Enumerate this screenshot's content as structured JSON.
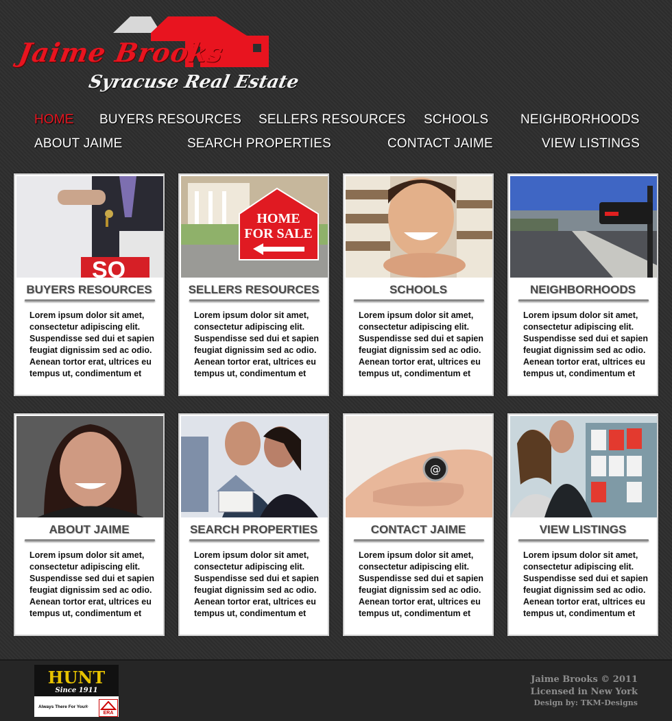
{
  "logo": {
    "name": "Jaime Brooks",
    "tagline": "Syracuse Real Estate"
  },
  "colors": {
    "accent": "#e8141f",
    "background": "#2e2e2e",
    "card": "#ffffff"
  },
  "nav": [
    {
      "label": "HOME",
      "active": true
    },
    {
      "label": "BUYERS RESOURCES"
    },
    {
      "label": "SELLERS RESOURCES"
    },
    {
      "label": "SCHOOLS"
    },
    {
      "label": "NEIGHBORHOODS"
    },
    {
      "label": "ABOUT JAIME"
    },
    {
      "label": "SEARCH PROPERTIES"
    },
    {
      "label": "CONTACT JAIME"
    },
    {
      "label": "VIEW LISTINGS"
    }
  ],
  "cards": [
    {
      "title": "BUYERS RESOURCES",
      "image": "hand-holding-keys-photo",
      "text": "Lorem ipsum dolor sit amet, consectetur adipiscing elit. Suspendisse sed dui et sapien feugiat dignissim sed ac odio. Aenean tortor erat, ultrices eu tempus ut, condimentum et"
    },
    {
      "title": "SELLERS RESOURCES",
      "image": "home-for-sale-sign-photo",
      "sign_text": "HOME FOR SALE",
      "text": "Lorem ipsum dolor sit amet, consectetur adipiscing elit. Suspendisse sed dui et sapien feugiat dignissim sed ac odio. Aenean tortor erat, ultrices eu tempus ut, condimentum et"
    },
    {
      "title": "SCHOOLS",
      "image": "smiling-child-books-photo",
      "text": "Lorem ipsum dolor sit amet, consectetur adipiscing elit. Suspendisse sed dui et sapien feugiat dignissim sed ac odio. Aenean tortor erat, ultrices eu tempus ut, condimentum et"
    },
    {
      "title": "NEIGHBORHOODS",
      "image": "mailbox-street-photo",
      "text": "Lorem ipsum dolor sit amet, consectetur adipiscing elit. Suspendisse sed dui et sapien feugiat dignissim sed ac odio. Aenean tortor erat, ultrices eu tempus ut, condimentum et"
    },
    {
      "title": "ABOUT JAIME",
      "image": "agent-portrait-photo",
      "text": "Lorem ipsum dolor sit amet, consectetur adipiscing elit. Suspendisse sed dui et sapien feugiat dignissim sed ac odio. Aenean tortor erat, ultrices eu tempus ut, condimentum et"
    },
    {
      "title": "SEARCH PROPERTIES",
      "image": "couple-house-model-photo",
      "text": "Lorem ipsum dolor sit amet, consectetur adipiscing elit. Suspendisse sed dui et sapien feugiat dignissim sed ac odio. Aenean tortor erat, ultrices eu tempus ut, condimentum et"
    },
    {
      "title": "CONTACT JAIME",
      "image": "hand-email-button-photo",
      "text": "Lorem ipsum dolor sit amet, consectetur adipiscing elit. Suspendisse sed dui et sapien feugiat dignissim sed ac odio. Aenean tortor erat, ultrices eu tempus ut, condimentum et"
    },
    {
      "title": "VIEW LISTINGS",
      "image": "couple-viewing-listings-photo",
      "text": "Lorem ipsum dolor sit amet, consectetur adipiscing elit. Suspendisse sed dui et sapien feugiat dignissim sed ac odio. Aenean tortor erat, ultrices eu tempus ut, condimentum et"
    }
  ],
  "footer": {
    "brand": "HUNT",
    "brand_since": "Since 1911",
    "brand_slogan": "Always There For You®",
    "partner": "ERA",
    "copyright": "Jaime Brooks © 2011",
    "license": "Licensed in New York",
    "design": "Design by: TKM-Designs"
  }
}
